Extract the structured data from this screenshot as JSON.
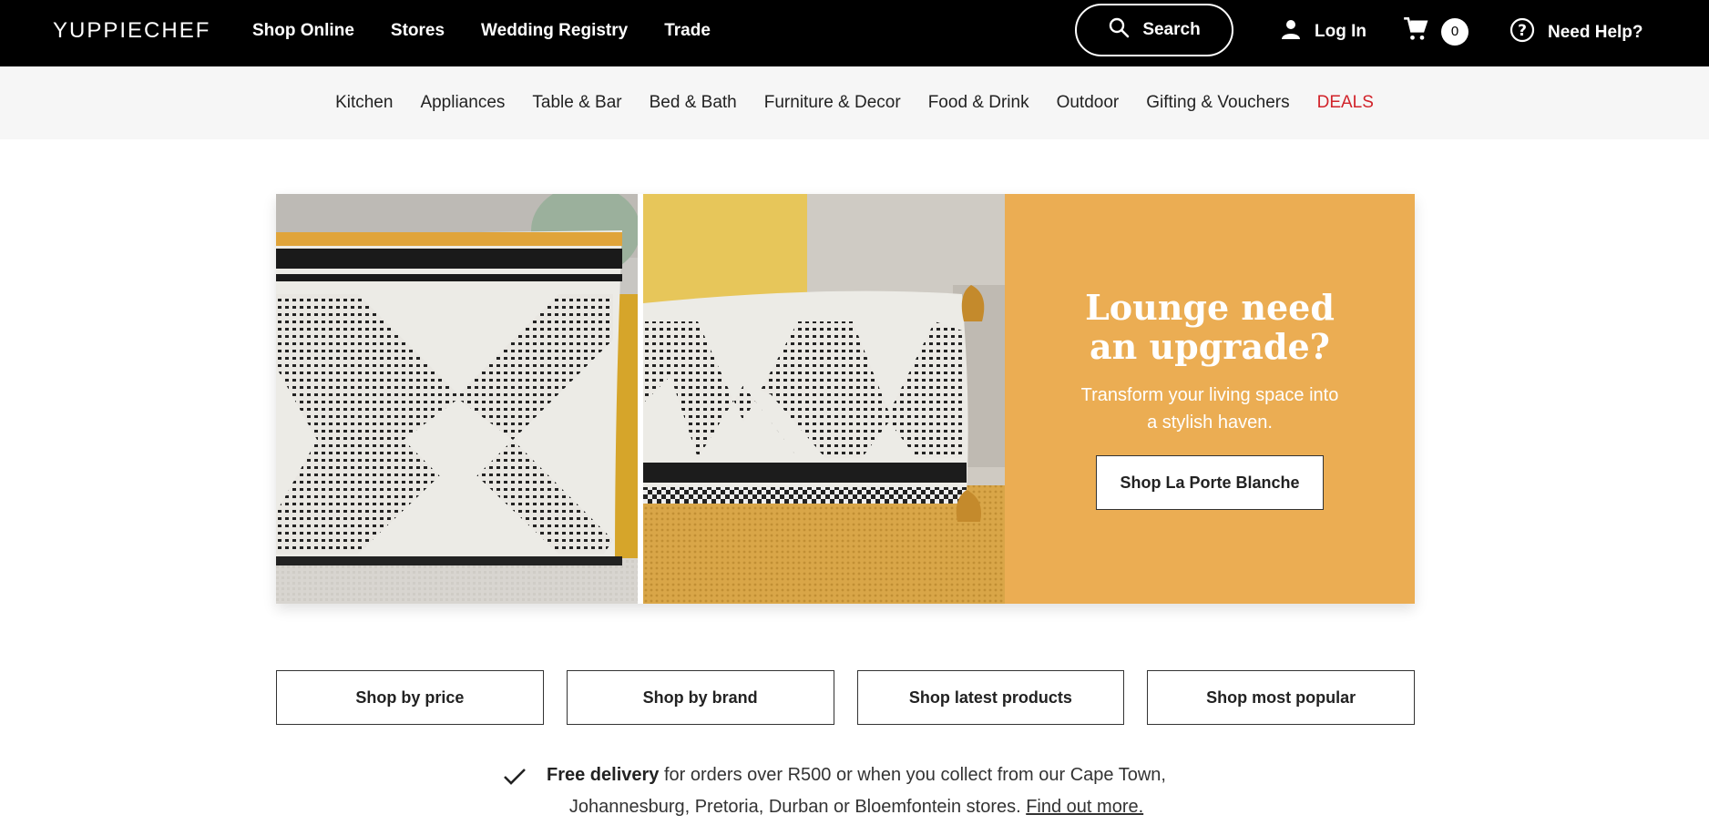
{
  "header": {
    "logo": "YUPPIECHEF",
    "nav": [
      "Shop Online",
      "Stores",
      "Wedding Registry",
      "Trade"
    ],
    "search_label": "Search",
    "login_label": "Log In",
    "cart_count": "0",
    "help_label": "Need Help?"
  },
  "categories": [
    "Kitchen",
    "Appliances",
    "Table & Bar",
    "Bed & Bath",
    "Furniture & Decor",
    "Food & Drink",
    "Outdoor",
    "Gifting & Vouchers",
    "DEALS"
  ],
  "hero": {
    "title": "Lounge need\nan upgrade?",
    "subtitle": "Transform your living space into a stylish haven.",
    "cta": "Shop La Porte Blanche"
  },
  "shop_buttons": [
    "Shop by price",
    "Shop by brand",
    "Shop latest products",
    "Shop most popular"
  ],
  "delivery": {
    "bold": "Free delivery",
    "text": " for orders over R500 or when you collect from our Cape Town, Johannesburg, Pretoria, Durban or Bloemfontein stores. ",
    "link": "Find out more."
  },
  "colors": {
    "topbar": "#000000",
    "promo": "#ebad53",
    "deals": "#d1232a"
  }
}
